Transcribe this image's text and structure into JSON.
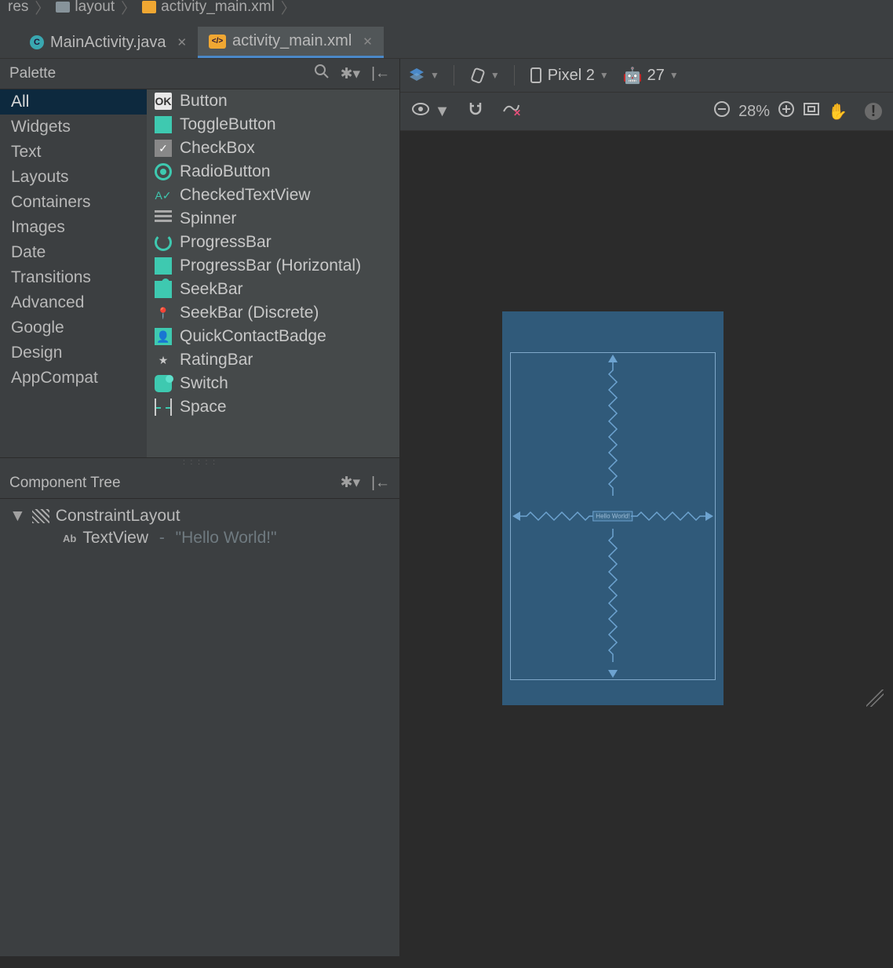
{
  "breadcrumb": {
    "res": "res",
    "layout": "layout",
    "file": "activity_main.xml"
  },
  "tabs": [
    {
      "label": "MainActivity.java",
      "active": false
    },
    {
      "label": "activity_main.xml",
      "active": true
    }
  ],
  "palette": {
    "title": "Palette",
    "categories": [
      "All",
      "Widgets",
      "Text",
      "Layouts",
      "Containers",
      "Images",
      "Date",
      "Transitions",
      "Advanced",
      "Google",
      "Design",
      "AppCompat"
    ],
    "selected_category": "All",
    "items": [
      {
        "label": "Button",
        "icon": "ok"
      },
      {
        "label": "ToggleButton",
        "icon": "toggle"
      },
      {
        "label": "CheckBox",
        "icon": "check"
      },
      {
        "label": "RadioButton",
        "icon": "radio"
      },
      {
        "label": "CheckedTextView",
        "icon": "checkedtext"
      },
      {
        "label": "Spinner",
        "icon": "spinner"
      },
      {
        "label": "ProgressBar",
        "icon": "progress"
      },
      {
        "label": "ProgressBar (Horizontal)",
        "icon": "hprogress"
      },
      {
        "label": "SeekBar",
        "icon": "seekbar"
      },
      {
        "label": "SeekBar (Discrete)",
        "icon": "pin"
      },
      {
        "label": "QuickContactBadge",
        "icon": "contact"
      },
      {
        "label": "RatingBar",
        "icon": "star"
      },
      {
        "label": "Switch",
        "icon": "switch"
      },
      {
        "label": "Space",
        "icon": "space"
      }
    ]
  },
  "component_tree": {
    "title": "Component Tree",
    "root": "ConstraintLayout",
    "child_type": "TextView",
    "child_text": "\"Hello World!\""
  },
  "design_toolbar": {
    "device": "Pixel 2",
    "api": "27",
    "zoom": "28%"
  },
  "preview": {
    "text": "Hello World!"
  }
}
